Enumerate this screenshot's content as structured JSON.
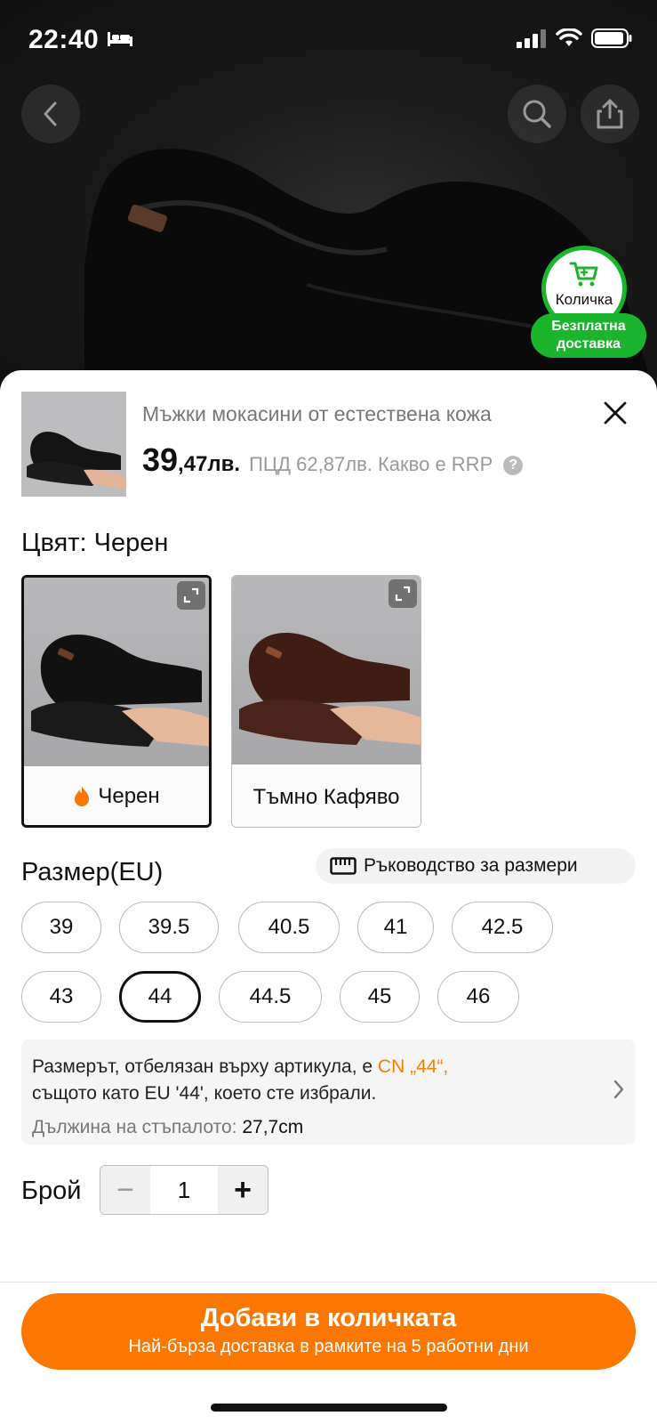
{
  "status_bar": {
    "time": "22:40"
  },
  "floating_cart": {
    "label": "Количка",
    "shipping": [
      "Безплатна",
      "доставка"
    ]
  },
  "product": {
    "title": "Мъжки мокасини от естествена кожа",
    "price_int": "39",
    "price_dec": ",47лв.",
    "rrp_text": "ПЦД 62,87лв. Какво е RRP",
    "help_glyph": "?"
  },
  "color_section": {
    "label": "Цвят: Черен",
    "options": [
      {
        "label": "Черен",
        "selected": true,
        "color": "#1a1a1a"
      },
      {
        "label": "Тъмно Кафяво",
        "selected": false,
        "color": "#4a231a"
      }
    ]
  },
  "size_section": {
    "label": "Размер(EU)",
    "guide_label": "Ръководство за размери",
    "sizes": [
      "39",
      "39.5",
      "40.5",
      "41",
      "42.5",
      "43",
      "44",
      "44.5",
      "45",
      "46"
    ],
    "selected": "44"
  },
  "size_info": {
    "line1_prefix": "Размерът, отбелязан върху артикула, е ",
    "line1_accent": "CN „44“,",
    "line2": "същото като EU '44', което сте избрали.",
    "foot_label": "Дължина на стъпалото: ",
    "foot_value": "27,7cm"
  },
  "quantity": {
    "label": "Брой",
    "value": "1",
    "minus": "−",
    "plus": "+"
  },
  "add_button": {
    "label": "Добави в количката",
    "sublabel": "Най-бърза доставка в рамките на 5 работни дни"
  },
  "colors": {
    "accent": "#fb7701",
    "green": "#1bb52d",
    "accent_text": "#f77f00"
  }
}
